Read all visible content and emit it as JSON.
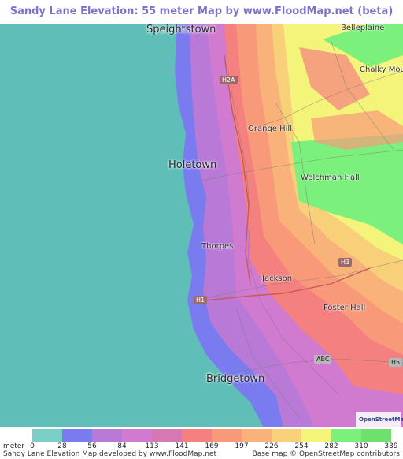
{
  "title": "Sandy Lane Elevation: 55 meter Map by www.FloodMap.net (beta)",
  "map": {
    "places": [
      {
        "key": "speightstown",
        "label": "Speightstown",
        "size": "big"
      },
      {
        "key": "belleplaine",
        "label": "Belleplaine",
        "size": "small"
      },
      {
        "key": "chalky",
        "label": "Chalky Moun",
        "size": "small"
      },
      {
        "key": "orange",
        "label": "Orange Hill",
        "size": "small"
      },
      {
        "key": "holetown",
        "label": "Holetown",
        "size": "big"
      },
      {
        "key": "welchman",
        "label": "Welchman Hall",
        "size": "small"
      },
      {
        "key": "thorpes",
        "label": "Thorpes",
        "size": "small"
      },
      {
        "key": "jackson",
        "label": "Jackson",
        "size": "small"
      },
      {
        "key": "fosterhall",
        "label": "Foster Hall",
        "size": "small"
      },
      {
        "key": "bridgetown",
        "label": "Bridgetown",
        "size": "big"
      }
    ],
    "shields": [
      {
        "key": "h2a",
        "label": "H2A"
      },
      {
        "key": "h3",
        "label": "H3"
      },
      {
        "key": "h1",
        "label": "H1"
      },
      {
        "key": "abc",
        "label": "ABC"
      },
      {
        "key": "h5",
        "label": "H5"
      }
    ],
    "osm_logo": "OpenStreetMap"
  },
  "legend": {
    "unit": "meter",
    "ticks": [
      "0",
      "28",
      "56",
      "84",
      "113",
      "141",
      "169",
      "197",
      "226",
      "254",
      "282",
      "310",
      "339"
    ],
    "colors": [
      "#7ccfc7",
      "#7b7bf0",
      "#b87ad6",
      "#d07ad0",
      "#d678b4",
      "#f58080",
      "#f89a7a",
      "#f8b27a",
      "#f8d07a",
      "#f4f47a",
      "#7cf07c",
      "#6ee06e"
    ],
    "credit_left": "Sandy Lane Elevation Map developed by www.FloodMap.net",
    "credit_right": "Base map © OpenStreetMap contributors"
  }
}
